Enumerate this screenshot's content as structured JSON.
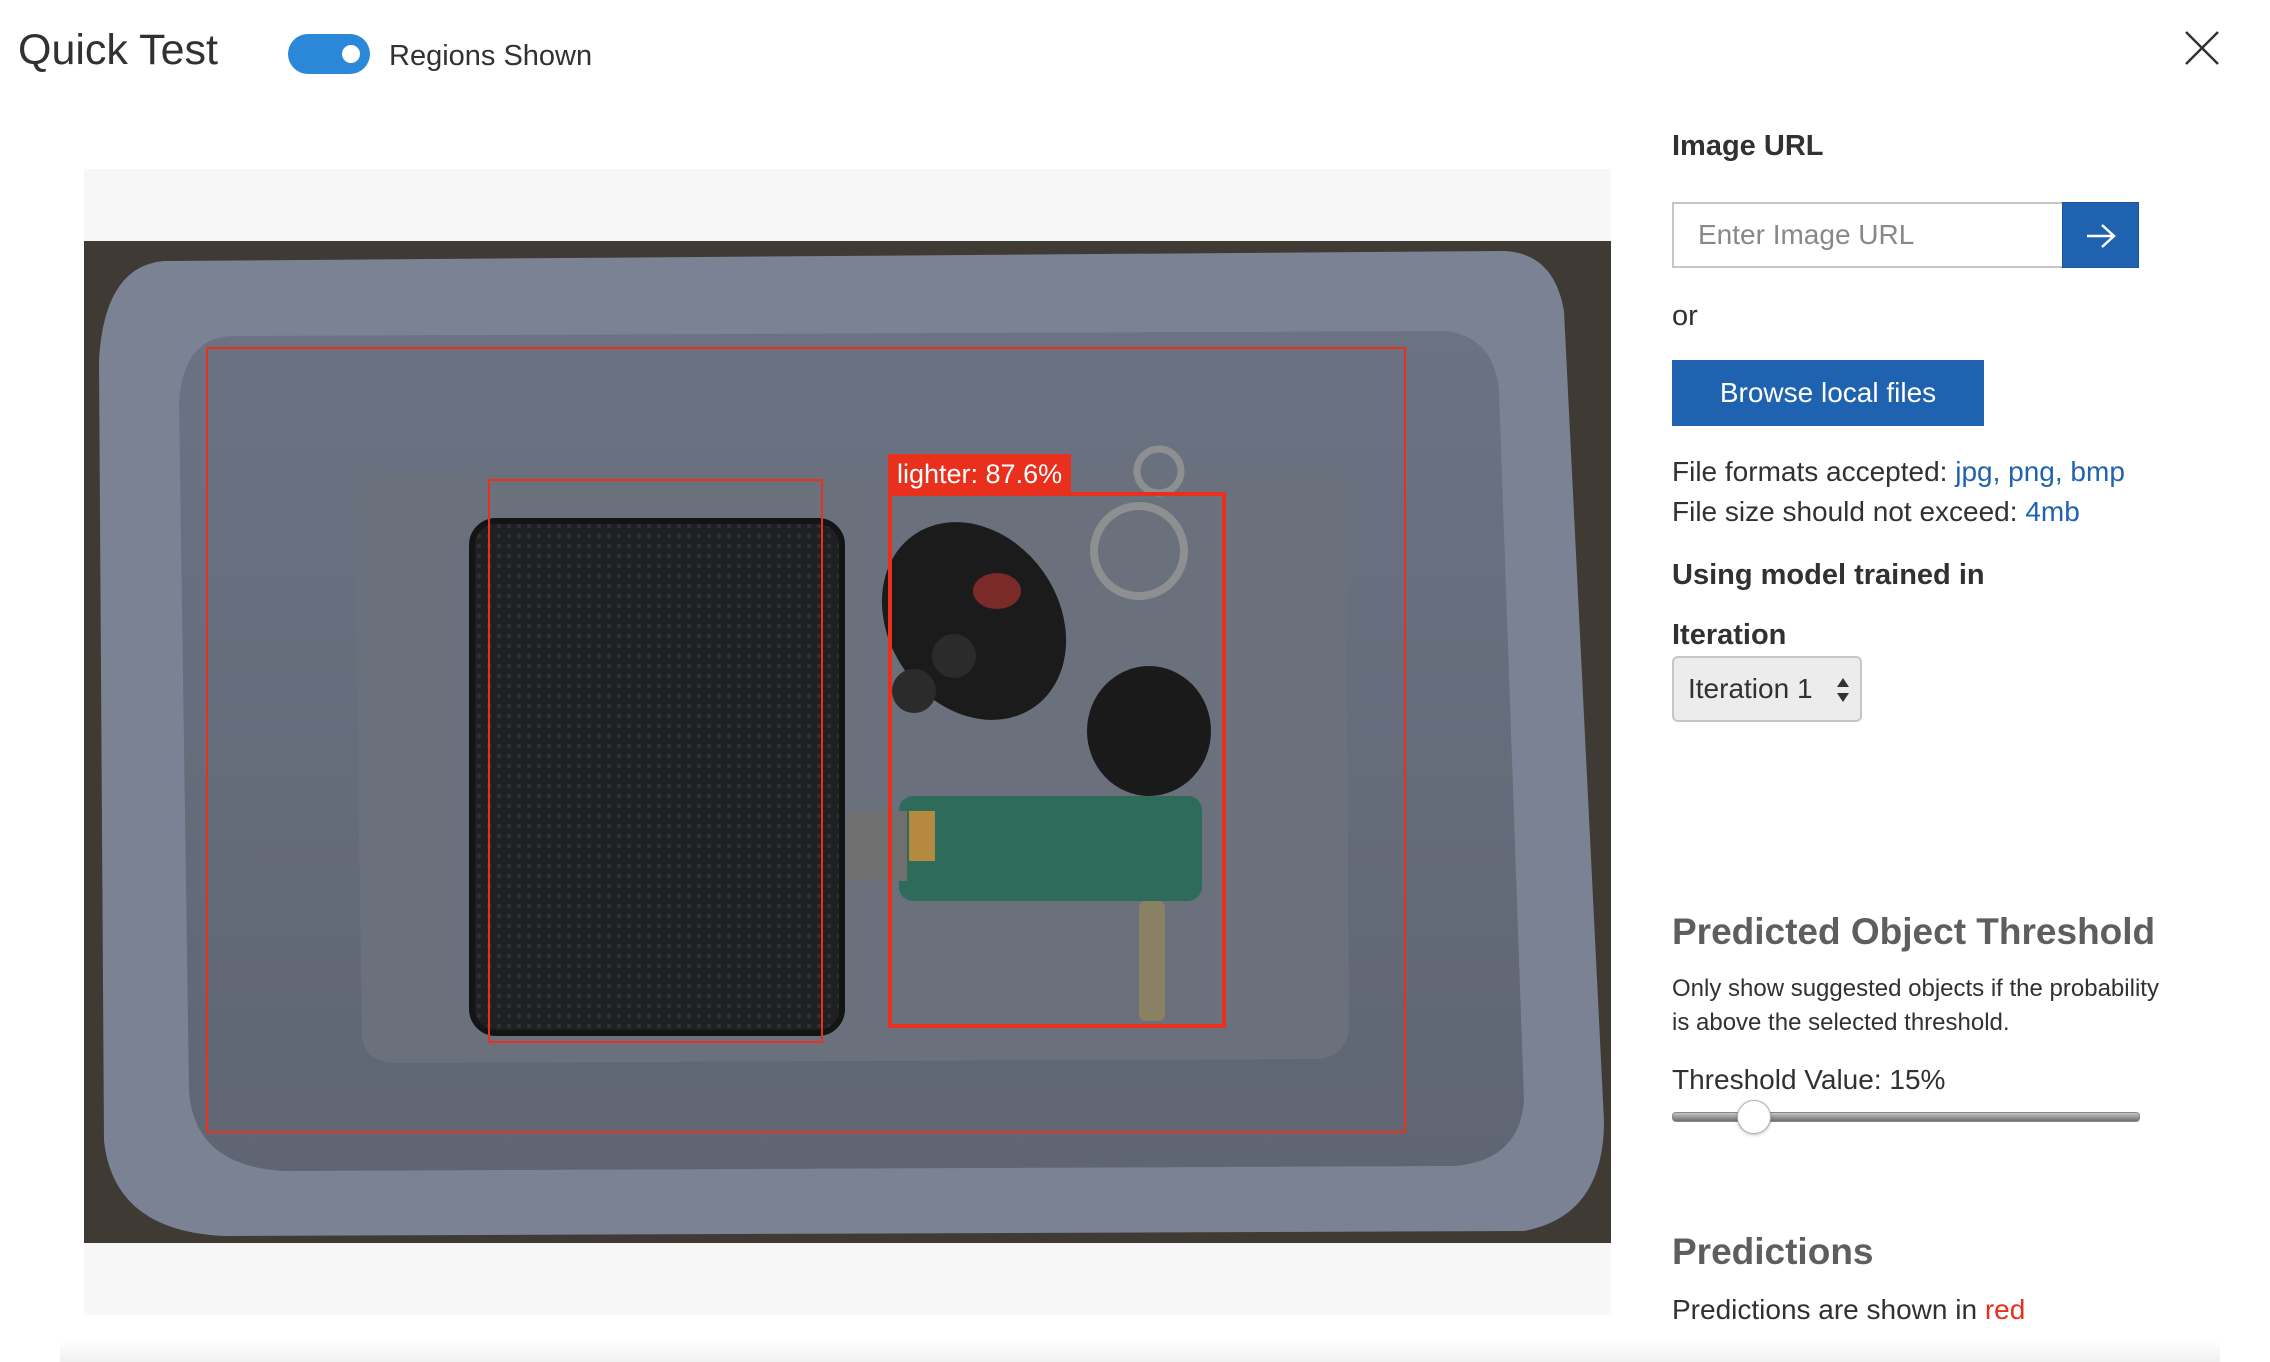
{
  "header": {
    "title": "Quick Test",
    "toggle_label": "Regions Shown",
    "toggle_on": true
  },
  "image": {
    "regions": [
      {
        "label": "lighter: 87.6%",
        "selected": true
      },
      {
        "label": "",
        "selected": false
      },
      {
        "label": "",
        "selected": false
      }
    ]
  },
  "panel": {
    "image_url_heading": "Image URL",
    "url_placeholder": "Enter Image URL",
    "or_text": "or",
    "browse_label": "Browse local files",
    "formats_prefix": "File formats accepted:",
    "formats_value": "jpg, png, bmp",
    "size_prefix": "File size should not exceed:",
    "size_value": "4mb",
    "model_heading": "Using model trained in",
    "iteration_heading": "Iteration",
    "iteration_selected": "Iteration 1",
    "threshold_title": "Predicted Object Threshold",
    "threshold_desc": "Only show suggested objects if the probability is above the selected threshold.",
    "threshold_label": "Threshold Value: 15%",
    "threshold_percent": 15,
    "predictions_title": "Predictions",
    "predictions_prefix": "Predictions are shown in",
    "predictions_color_word": "red"
  },
  "colors": {
    "accent": "#1f63b0",
    "toggle": "#2b88d8",
    "prediction": "#e8301c"
  },
  "icons": {
    "close": "close-icon",
    "go": "arrow-right-icon",
    "select": "updown-arrows-icon"
  }
}
